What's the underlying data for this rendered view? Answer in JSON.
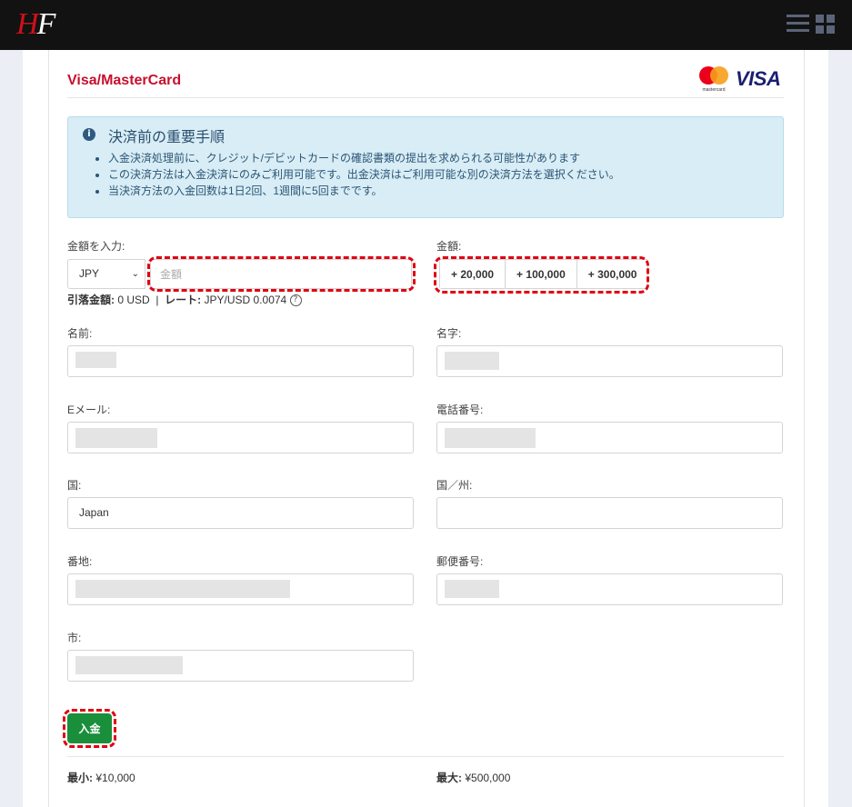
{
  "header": {
    "logo_h": "H",
    "logo_f": "F",
    "menu_icon": "hamburger-icon",
    "apps_icon": "grid-icon"
  },
  "payment": {
    "title": "Visa/MasterCard",
    "mastercard_label": "mastercard",
    "visa_label": "VISA"
  },
  "notice": {
    "title": "決済前の重要手順",
    "items": [
      "入金決済処理前に、クレジット/デビットカードの確認書類の提出を求められる可能性があります",
      "この決済方法は入金決済にのみご利用可能です。出金決済はご利用可能な別の決済方法を選択ください。",
      "当決済方法の入金回数は1日2回、1週間に5回までです。"
    ]
  },
  "amount": {
    "label": "金額を入力:",
    "currency": "JPY",
    "placeholder": "金額",
    "quick_label": "金額:",
    "quick_buttons": [
      "+ 20,000",
      "+ 100,000",
      "+ 300,000"
    ],
    "debit_label": "引落金額:",
    "debit_value": "0 USD",
    "separator": "|",
    "rate_label": "レート:",
    "rate_value": "JPY/USD 0.0074",
    "help": "?"
  },
  "form": {
    "first_name_label": "名前:",
    "last_name_label": "名字:",
    "email_label": "Eメール:",
    "phone_label": "電話番号:",
    "country_label": "国:",
    "country_value": "Japan",
    "state_label": "国／州:",
    "address_label": "番地:",
    "zip_label": "郵便番号:",
    "city_label": "市:"
  },
  "submit_label": "入金",
  "limits": {
    "min_label": "最小:",
    "min_value": "¥10,000",
    "max_label": "最大:",
    "max_value": "¥500,000"
  }
}
